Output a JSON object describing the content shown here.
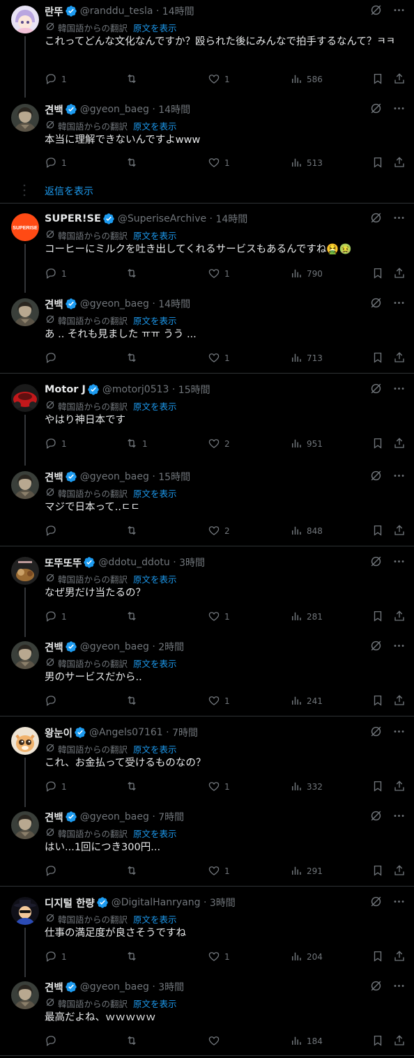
{
  "labels": {
    "translated": "韓国語からの翻訳",
    "show_original": "原文を表示",
    "show_replies": "返信を表示"
  },
  "tweets": [
    {
      "name": "란뚜",
      "handle": "@randdu_tesla",
      "time": "14時間",
      "text": "これってどんな文化なんですか？殴られた後にみんなで拍手するなんて？ㅋㅋ",
      "replies": "1",
      "retweets": "",
      "likes": "1",
      "views": "586",
      "avatar": "anime"
    },
    {
      "name": "견백",
      "handle": "@gyeon_baeg",
      "time": "14時間",
      "text": "本当に理解できないんですよwww",
      "replies": "1",
      "retweets": "",
      "likes": "1",
      "views": "513",
      "avatar": "gyeon"
    },
    {
      "name": "SUPER!SE",
      "handle": "@SuperiseArchive",
      "time": "14時間",
      "text": "コーヒーにミルクを吐き出してくれるサービスもあるんですね🤮🤢",
      "replies": "1",
      "retweets": "",
      "likes": "1",
      "views": "790",
      "avatar": "superise",
      "avatar_text": "SUPERISE"
    },
    {
      "name": "견백",
      "handle": "@gyeon_baeg",
      "time": "14時間",
      "text": "あ .. それも見ました ㅠㅠ うう ...",
      "replies": "",
      "retweets": "",
      "likes": "1",
      "views": "713",
      "avatar": "gyeon"
    },
    {
      "name": "Motor J",
      "handle": "@motorj0513",
      "time": "15時間",
      "text": "やはり神日本です",
      "replies": "1",
      "retweets": "1",
      "likes": "2",
      "views": "951",
      "avatar": "motor"
    },
    {
      "name": "견백",
      "handle": "@gyeon_baeg",
      "time": "15時間",
      "text": "マジで日本って..ㄷㄷ",
      "replies": "",
      "retweets": "",
      "likes": "2",
      "views": "848",
      "avatar": "gyeon"
    },
    {
      "name": "또뚜또뚜",
      "handle": "@ddotu_ddotu",
      "time": "3時間",
      "text": "なぜ男だけ当たるの？",
      "replies": "1",
      "retweets": "",
      "likes": "1",
      "views": "281",
      "avatar": "ddotu"
    },
    {
      "name": "견백",
      "handle": "@gyeon_baeg",
      "time": "2時間",
      "text": "男のサービスだから..",
      "replies": "",
      "retweets": "",
      "likes": "1",
      "views": "241",
      "avatar": "gyeon"
    },
    {
      "name": "왕눈이",
      "handle": "@Angels07161",
      "time": "7時間",
      "text": "これ、お金払って受けるものなの？",
      "replies": "1",
      "retweets": "",
      "likes": "1",
      "views": "332",
      "avatar": "cat"
    },
    {
      "name": "견백",
      "handle": "@gyeon_baeg",
      "time": "7時間",
      "text": "はい...1回につき300円...",
      "replies": "",
      "retweets": "",
      "likes": "1",
      "views": "291",
      "avatar": "gyeon"
    },
    {
      "name": "디지털 한량",
      "handle": "@DigitalHanryang",
      "time": "3時間",
      "text": "仕事の満足度が良さそうですね",
      "replies": "1",
      "retweets": "",
      "likes": "1",
      "views": "204",
      "avatar": "hanryang"
    },
    {
      "name": "견백",
      "handle": "@gyeon_baeg",
      "time": "3時間",
      "text": "最高だよね、ｗｗｗｗｗ",
      "replies": "",
      "retweets": "",
      "likes": "",
      "views": "184",
      "avatar": "gyeon"
    }
  ]
}
